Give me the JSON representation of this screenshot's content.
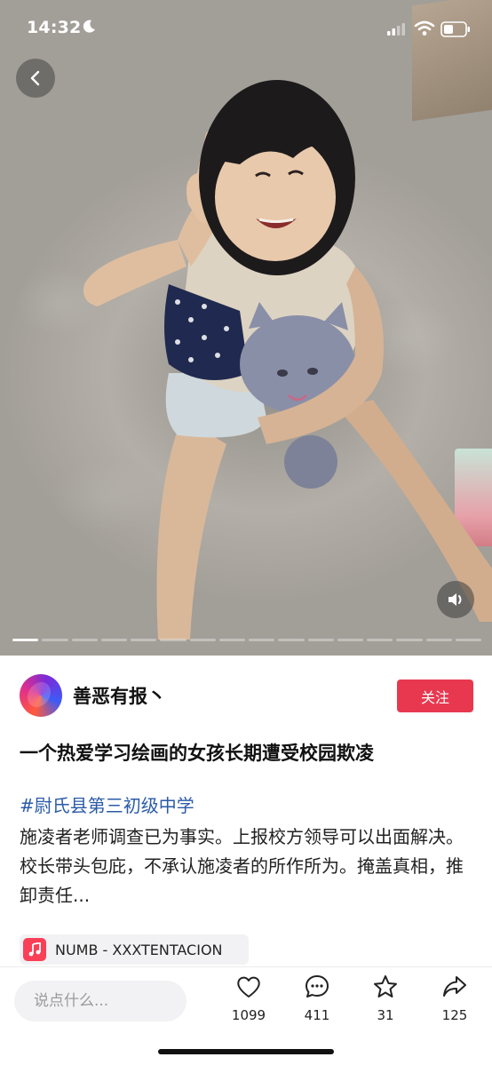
{
  "status_bar": {
    "time": "14:32"
  },
  "author": {
    "name": "善恶有报丶",
    "follow_label": "关注"
  },
  "post": {
    "title": "一个热爱学习绘画的女孩长期遭受校园欺凌",
    "hashtag": "#尉氏县第三初级中学",
    "body": "施凌者老师调查已为事实。上报校方领导可以出面解决。校长带头包庇，不承认施凌者的所作所为。掩盖真相，推卸责任..."
  },
  "music": {
    "label": "NUMB - XXXTENTACION"
  },
  "comment": {
    "placeholder": "说点什么..."
  },
  "actions": {
    "likes": "1099",
    "comments": "411",
    "favorites": "31",
    "shares": "125"
  },
  "colors": {
    "accent": "#e8384f",
    "hashtag": "#2b5aa8",
    "music": "#fa3f56"
  },
  "media": {
    "slide_count": 16,
    "current_slide": 1
  }
}
